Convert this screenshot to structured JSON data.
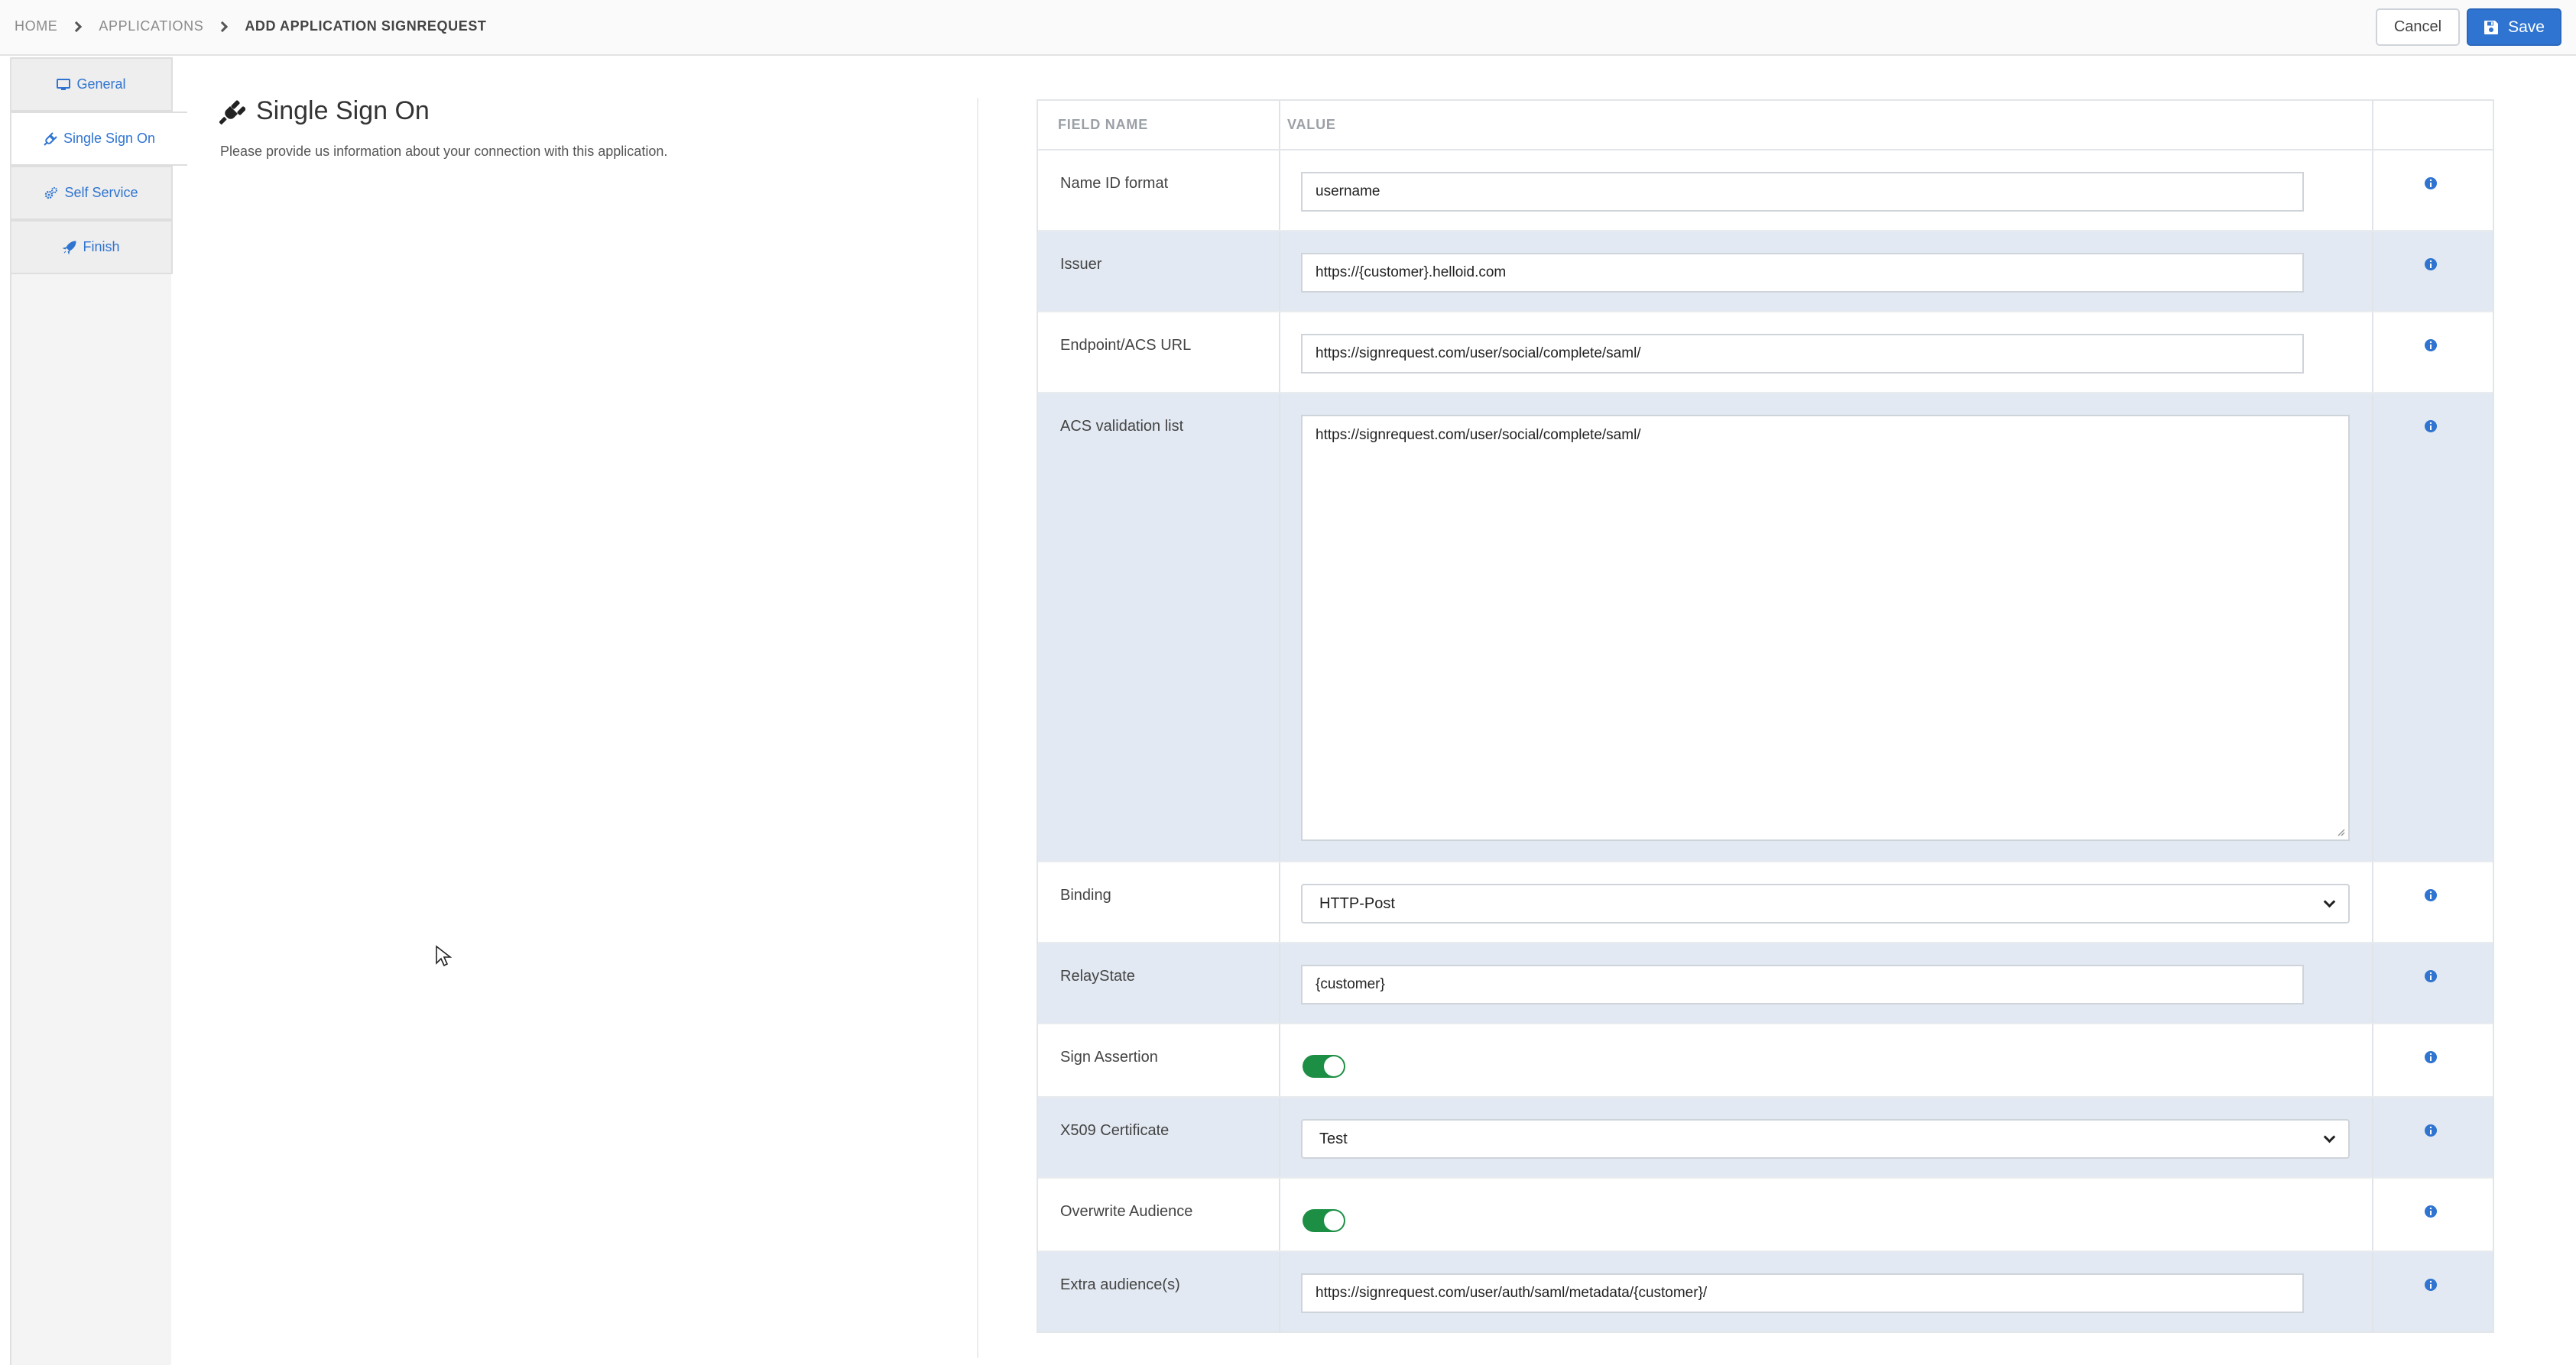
{
  "breadcrumb": [
    "HOME",
    "APPLICATIONS",
    "ADD APPLICATION SIGNREQUEST"
  ],
  "header": {
    "cancel_label": "Cancel",
    "save_label": "Save"
  },
  "sidebar": {
    "items": [
      {
        "label": "General",
        "icon": "monitor-icon",
        "active": false
      },
      {
        "label": "Single Sign On",
        "icon": "plug-icon",
        "active": true
      },
      {
        "label": "Self Service",
        "icon": "cogs-icon",
        "active": false
      },
      {
        "label": "Finish",
        "icon": "rocket-icon",
        "active": false
      }
    ]
  },
  "main": {
    "title": "Single Sign On",
    "subtitle": "Please provide us information about your connection with this application."
  },
  "table": {
    "headers": {
      "field": "FIELD NAME",
      "value": "VALUE"
    },
    "rows": [
      {
        "label": "Name ID format",
        "type": "input",
        "value": "username"
      },
      {
        "label": "Issuer",
        "type": "input",
        "value": "https://{customer}.helloid.com"
      },
      {
        "label": "Endpoint/ACS URL",
        "type": "input",
        "value": "https://signrequest.com/user/social/complete/saml/"
      },
      {
        "label": "ACS validation list",
        "type": "textarea",
        "value": "https://signrequest.com/user/social/complete/saml/"
      },
      {
        "label": "Binding",
        "type": "select",
        "value": "HTTP-Post"
      },
      {
        "label": "RelayState",
        "type": "input",
        "value": "{customer}"
      },
      {
        "label": "Sign Assertion",
        "type": "toggle",
        "on": true
      },
      {
        "label": "X509 Certificate",
        "type": "select",
        "value": "Test"
      },
      {
        "label": "Overwrite Audience",
        "type": "toggle",
        "on": true
      },
      {
        "label": "Extra audience(s)",
        "type": "input",
        "value": "https://signrequest.com/user/auth/saml/metadata/{customer}/"
      }
    ]
  },
  "colors": {
    "accent": "#2f74d0",
    "toggle_on": "#1d8f45",
    "row_alt": "#e2e9f2"
  }
}
